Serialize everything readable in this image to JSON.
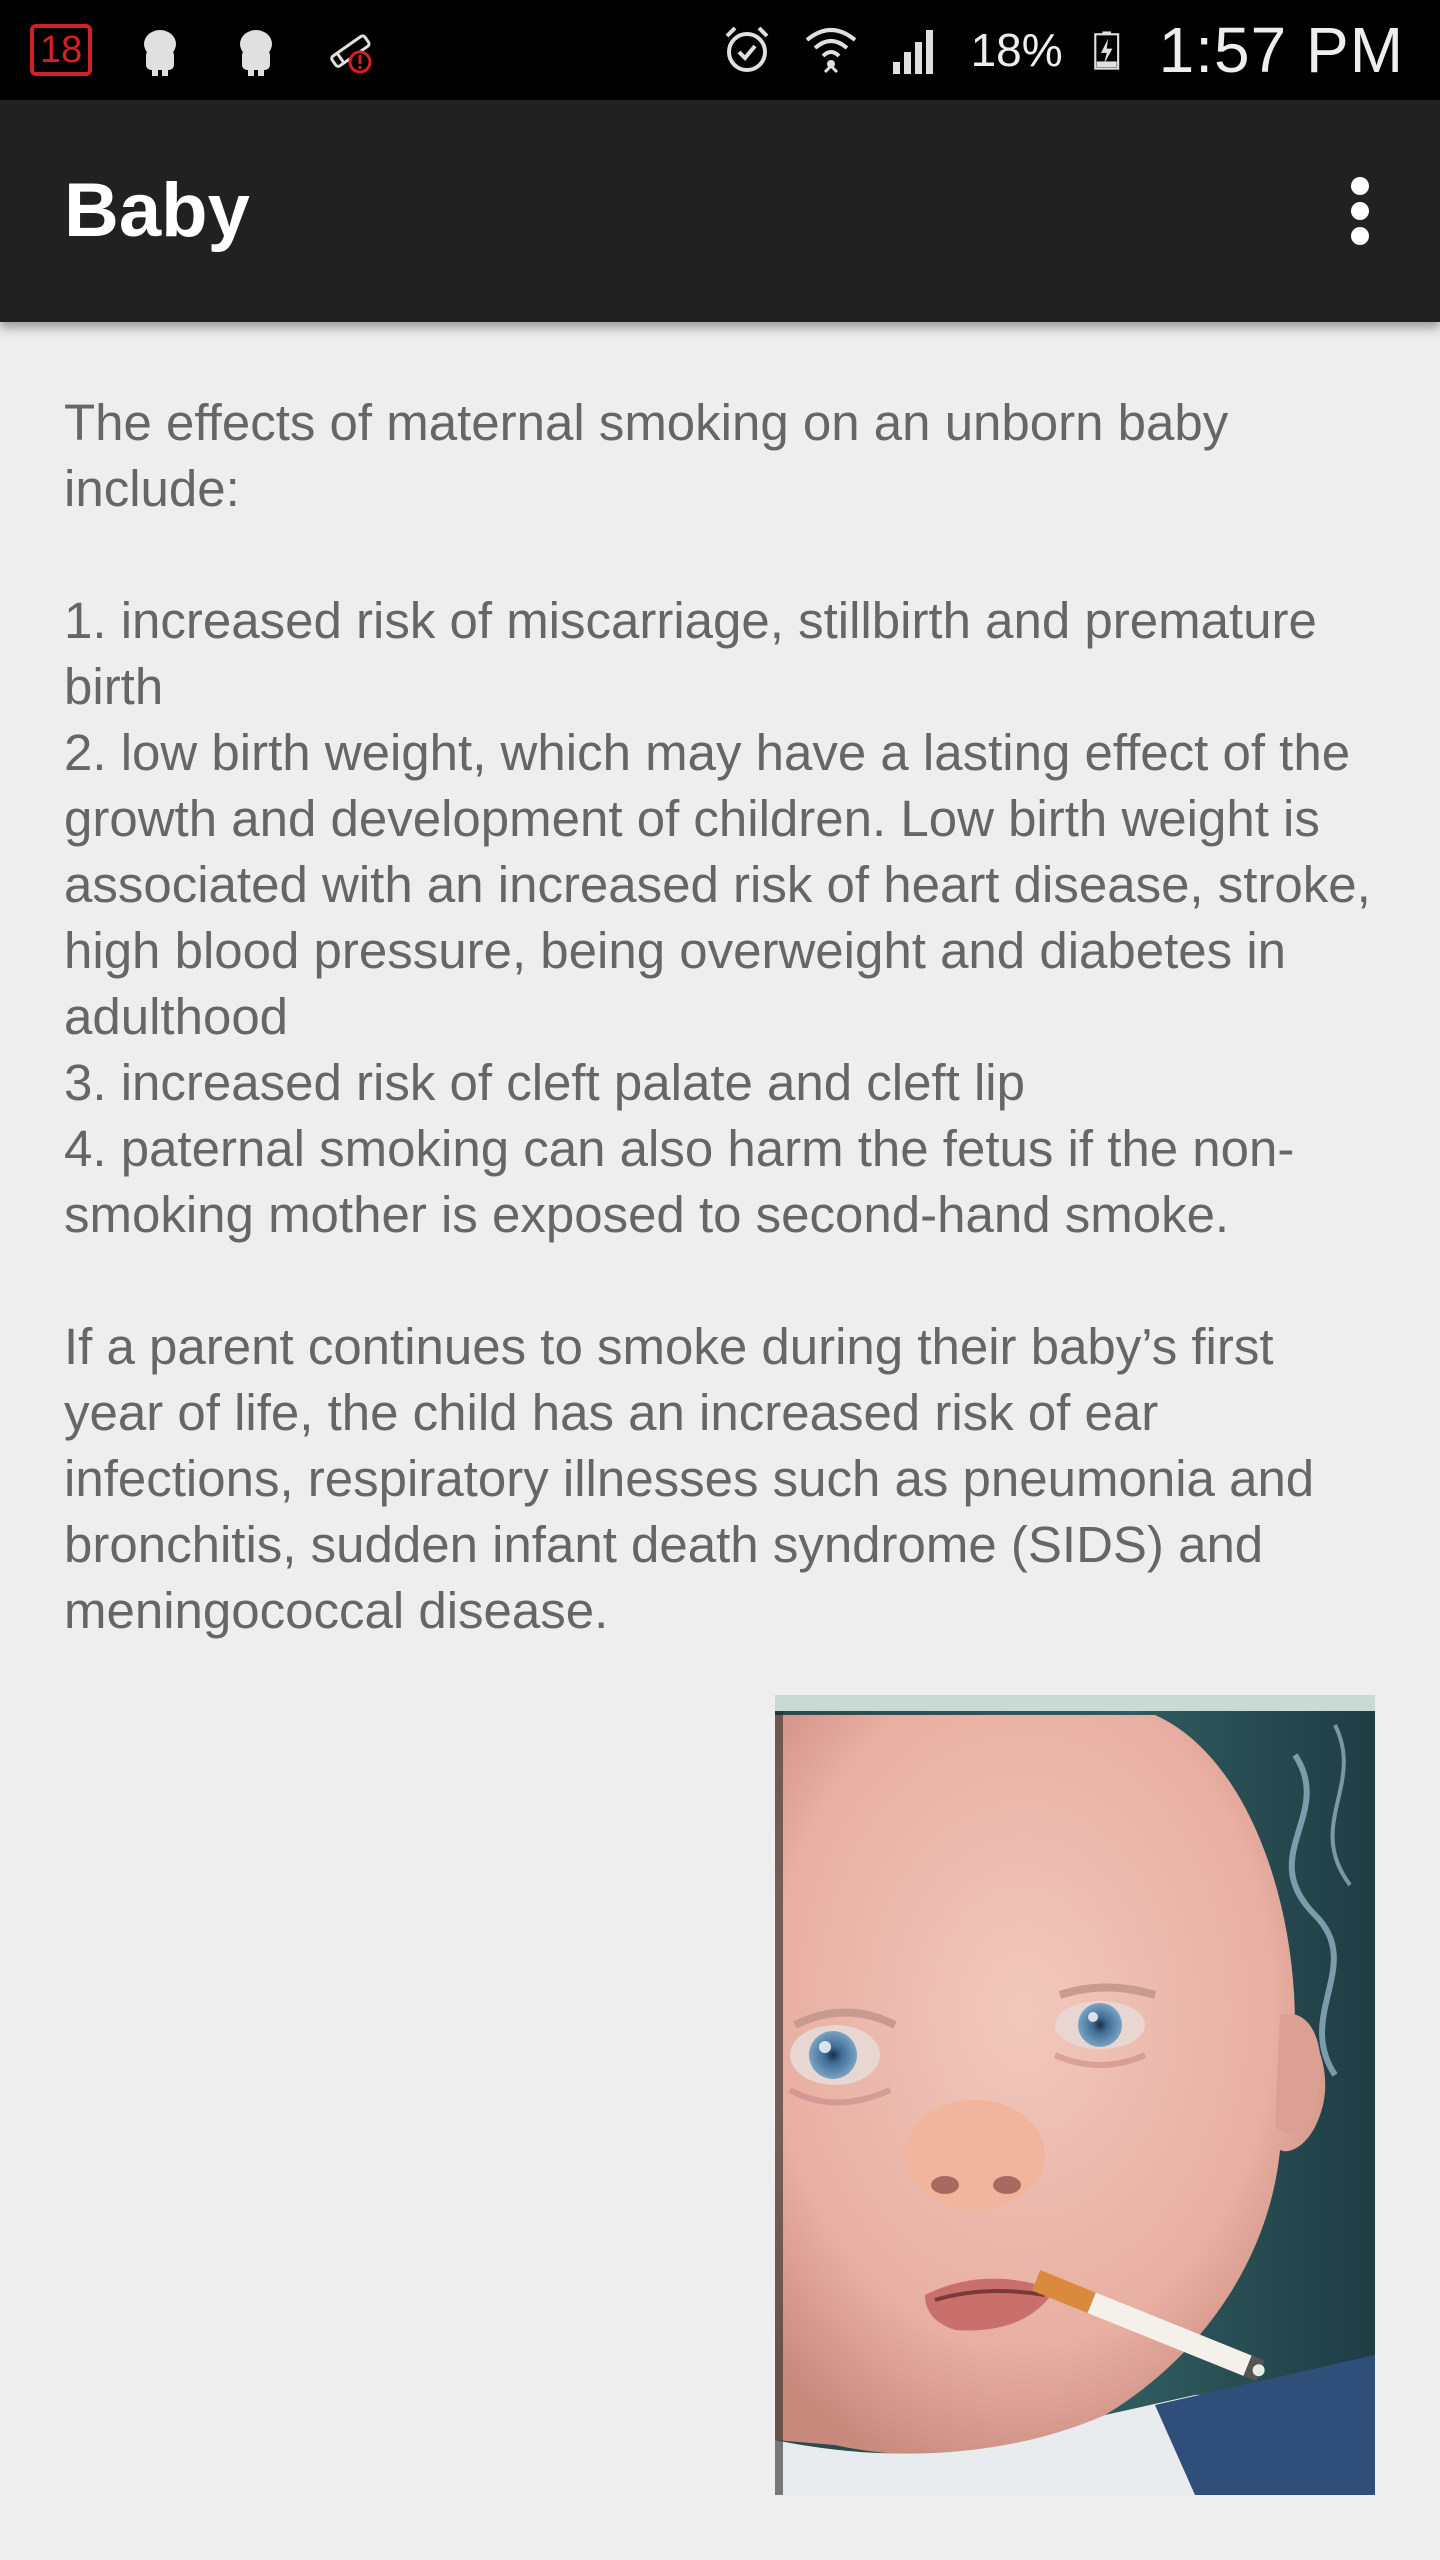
{
  "status_bar": {
    "notification_count": "18",
    "battery_percent": "18%",
    "time": "1:57 PM",
    "icons": [
      "gallery-icon",
      "android-icon",
      "android-icon",
      "no-smoking-alert-icon",
      "alarm-icon",
      "wifi-icon",
      "signal-icon",
      "battery-charging-icon"
    ]
  },
  "app_bar": {
    "title": "Baby",
    "overflow_icon": "more-vert-icon"
  },
  "article": {
    "intro": "The effects of maternal smoking on an unborn baby include:",
    "effects": [
      "1. increased risk of miscarriage, stillbirth and premature birth",
      "2. low birth weight, which may have a lasting effect of the growth and development of children. Low birth weight is associated with an increased risk of heart disease, stroke, high blood pressure, being overweight and diabetes in adulthood",
      "3. increased risk of cleft palate and cleft lip",
      "4. paternal smoking can also harm the fetus if the non-smoking mother is exposed to second-hand smoke."
    ],
    "closing": "If a parent continues to smoke during their baby’s first year of life, the child has an increased risk of ear infections, respiratory illnesses such as pneumonia and bronchitis, sudden infant death syndrome (SIDS) and meningococcal disease."
  },
  "colors": {
    "status_bar": "#000000",
    "app_bar": "#212121",
    "background": "#eeeeee",
    "body_text": "#666666",
    "notification_red": "#d32020"
  }
}
